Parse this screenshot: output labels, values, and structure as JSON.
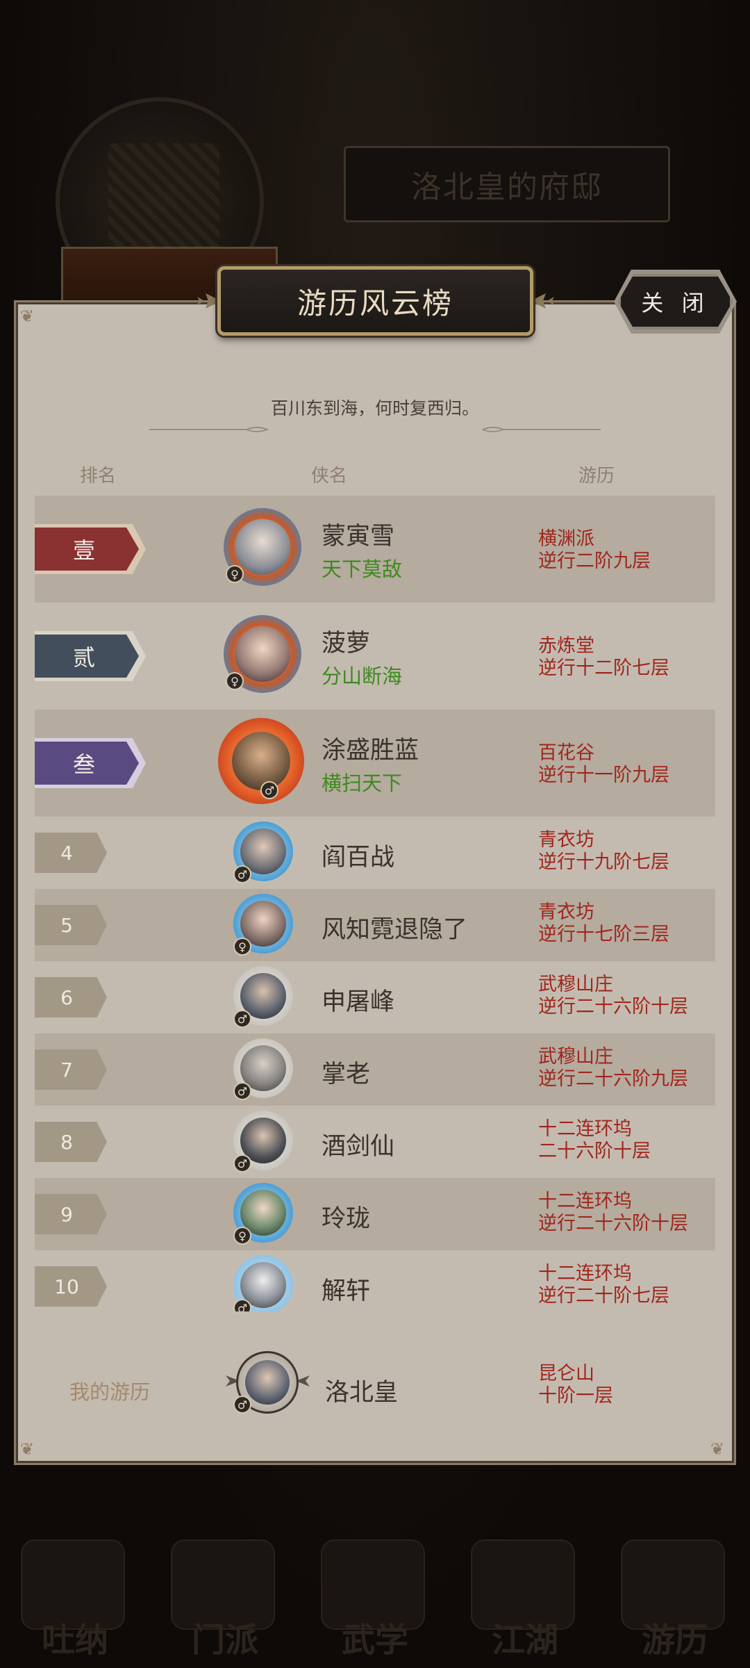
{
  "background": {
    "residence_title": "洛北皇的府邸",
    "stats_text": "",
    "nav_items": [
      "吐纳",
      "门派",
      "武学",
      "江湖",
      "游历"
    ]
  },
  "modal": {
    "title": "游历风云榜",
    "close_label": "关 闭",
    "subtitle": "百川东到海，何时复西归。",
    "columns": {
      "rank": "排名",
      "name": "侠名",
      "journey": "游历"
    },
    "colors": {
      "rank1": "#8a3132",
      "rank2": "#434e5c",
      "rank3": "#5a4a82",
      "sect_text": "#a0261d",
      "title_text": "#3d8a1e"
    },
    "rows": [
      {
        "rank": "壹",
        "name": "蒙寅雪",
        "title": "天下莫敌",
        "sect": "横渊派",
        "level": "逆行二阶九层",
        "gender": "♀"
      },
      {
        "rank": "贰",
        "name": "菠萝",
        "title": "分山断海",
        "sect": "赤炼堂",
        "level": "逆行十二阶七层",
        "gender": "♀"
      },
      {
        "rank": "叁",
        "name": "涂盛胜蓝",
        "title": "横扫天下",
        "sect": "百花谷",
        "level": "逆行十一阶九层",
        "gender": "♂"
      },
      {
        "rank": "4",
        "name": "阎百战",
        "title": "",
        "sect": "青衣坊",
        "level": "逆行十九阶七层",
        "gender": "♂"
      },
      {
        "rank": "5",
        "name": "风知霓退隐了",
        "title": "",
        "sect": "青衣坊",
        "level": "逆行十七阶三层",
        "gender": "♀"
      },
      {
        "rank": "6",
        "name": "申屠峰",
        "title": "",
        "sect": "武穆山庄",
        "level": "逆行二十六阶十层",
        "gender": "♂"
      },
      {
        "rank": "7",
        "name": "掌老",
        "title": "",
        "sect": "武穆山庄",
        "level": "逆行二十六阶九层",
        "gender": "♂"
      },
      {
        "rank": "8",
        "name": "酒剑仙",
        "title": "",
        "sect": "十二连环坞",
        "level": "二十六阶十层",
        "gender": "♂"
      },
      {
        "rank": "9",
        "name": "玲珑",
        "title": "",
        "sect": "十二连环坞",
        "level": "逆行二十六阶十层",
        "gender": "♀"
      },
      {
        "rank": "10",
        "name": "解轩",
        "title": "",
        "sect": "十二连环坞",
        "level": "逆行二十阶七层",
        "gender": "♂"
      }
    ],
    "me": {
      "label": "我的游历",
      "name": "洛北皇",
      "sect": "昆仑山",
      "level": "十阶一层",
      "gender": "♂"
    }
  }
}
